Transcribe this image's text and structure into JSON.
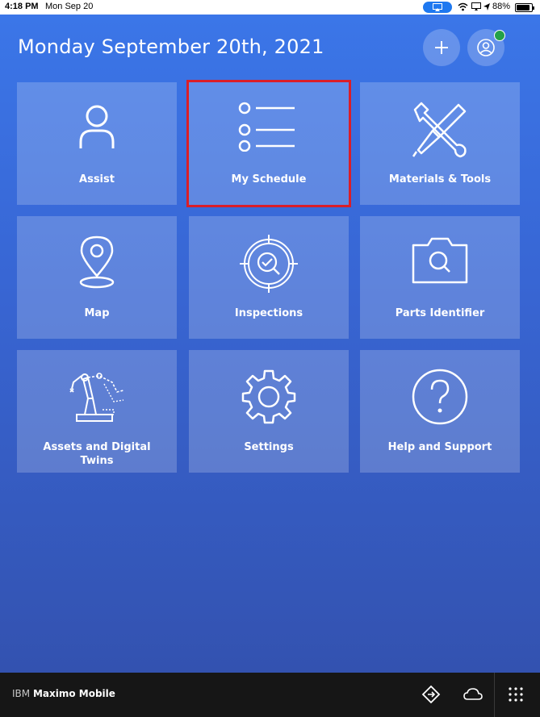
{
  "status_bar": {
    "time": "4:18 PM",
    "date": "Mon Sep 20",
    "battery": "88%",
    "battery_level": 0.88
  },
  "header": {
    "title": "Monday September 20th, 2021"
  },
  "tiles": [
    {
      "label": "Assist",
      "icon": "person-icon"
    },
    {
      "label": "My Schedule",
      "icon": "list-icon",
      "selected": true
    },
    {
      "label": "Materials & Tools",
      "icon": "tools-icon"
    },
    {
      "label": "Map",
      "icon": "map-pin-icon"
    },
    {
      "label": "Inspections",
      "icon": "inspection-target-icon"
    },
    {
      "label": "Parts Identifier",
      "icon": "camera-search-icon"
    },
    {
      "label": "Assets and Digital Twins",
      "icon": "robot-arm-icon"
    },
    {
      "label": "Settings",
      "icon": "gear-icon"
    },
    {
      "label": "Help and Support",
      "icon": "help-icon"
    }
  ],
  "bottom_bar": {
    "brand_prefix": "IBM",
    "brand_name": "Maximo Mobile"
  },
  "colors": {
    "accent": "#3b76e8",
    "selection_outline": "#da1e28",
    "online": "#24a148",
    "bottom_bar": "#161616"
  }
}
